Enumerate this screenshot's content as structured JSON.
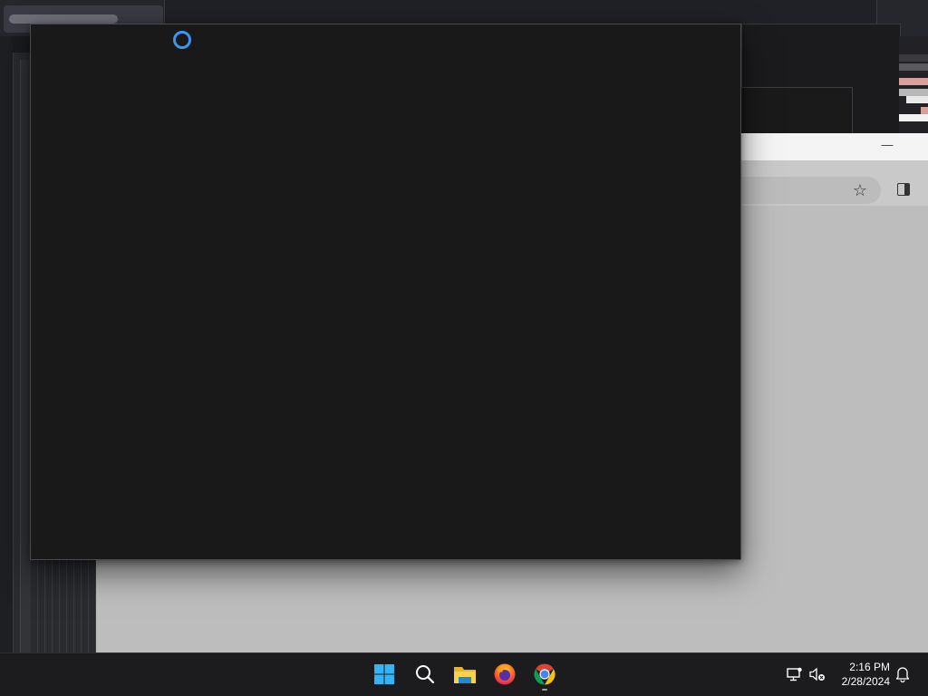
{
  "taskbar": {
    "apps": [
      {
        "name": "Start",
        "icon": "windows-logo-icon"
      },
      {
        "name": "Search",
        "icon": "search-icon"
      },
      {
        "name": "File Explorer",
        "icon": "folder-icon"
      },
      {
        "name": "Firefox",
        "icon": "firefox-icon"
      },
      {
        "name": "Google Chrome",
        "icon": "chrome-icon",
        "running": true
      }
    ],
    "tray": {
      "network_icon": "network-icon",
      "volume_icon": "volume-muted-icon",
      "time": "2:16 PM",
      "date": "2/28/2024",
      "notification_icon": "bell-icon"
    }
  },
  "browser": {
    "minimize_glyph": "—",
    "bookmark_icon": "star-icon",
    "sidepanel_icon": "side-panel-icon"
  },
  "front_window": {
    "state": "loading",
    "spinner_color": "#3d95f0"
  },
  "colors": {
    "accent": "#3d95f0",
    "taskbar_bg": "#1c1c1e",
    "window_bg": "#191919"
  }
}
